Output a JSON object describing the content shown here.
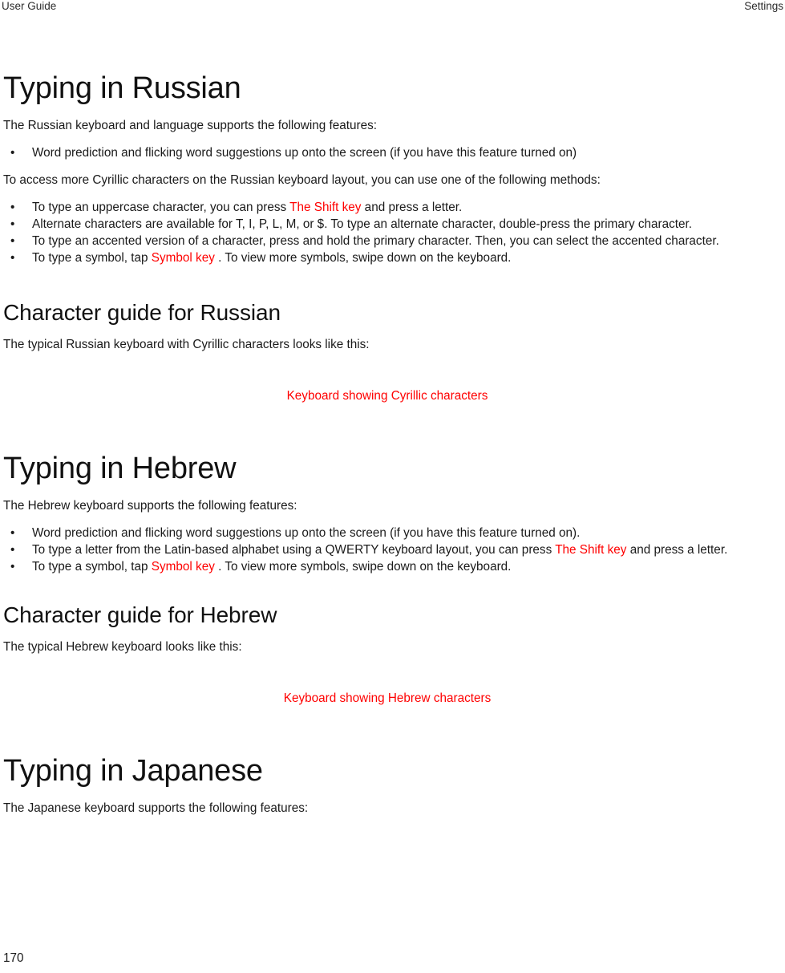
{
  "header": {
    "left": "User Guide",
    "right": "Settings"
  },
  "footer": {
    "page_number": "170"
  },
  "colors": {
    "alt_text_red": "#ff0000",
    "body_text": "#1a1a1a",
    "heading": "#111111",
    "background": "#ffffff"
  },
  "sections": {
    "russian": {
      "heading": "Typing in Russian",
      "intro": "The Russian keyboard and language supports the following features:",
      "features": [
        "Word prediction and flicking word suggestions up onto the screen (if you have this feature turned on)"
      ],
      "methods_intro": "To access more Cyrillic characters on the Russian keyboard layout, you can use one of the following methods:",
      "methods": [
        {
          "pre": "To type an uppercase character, you can press ",
          "alt": "The Shift key",
          "post": " and press a letter."
        },
        {
          "pre": "Alternate characters are available for T, I, P, L, M, or $. To type an alternate character, double-press the primary character.",
          "alt": "",
          "post": ""
        },
        {
          "pre": "To type an accented version of a character, press and hold the primary character. Then, you can select the accented character.",
          "alt": "",
          "post": ""
        },
        {
          "pre": "To type a symbol, tap ",
          "alt": "Symbol key",
          "post": " . To view more symbols, swipe down on the keyboard."
        }
      ],
      "guide_heading": "Character guide for Russian",
      "guide_intro": "The typical Russian keyboard with Cyrillic characters looks like this:",
      "figure_alt": "Keyboard showing Cyrillic characters"
    },
    "hebrew": {
      "heading": "Typing in Hebrew",
      "intro": "The Hebrew keyboard supports the following features:",
      "features": [
        {
          "pre": "Word prediction and flicking word suggestions up onto the screen (if you have this feature turned on).",
          "alt": "",
          "post": ""
        },
        {
          "pre": "To type a letter from the Latin-based alphabet using a QWERTY keyboard layout, you can press ",
          "alt": "The Shift key",
          "post": " and press a letter."
        },
        {
          "pre": "To type a symbol, tap ",
          "alt": "Symbol key",
          "post": " . To view more symbols, swipe down on the keyboard."
        }
      ],
      "guide_heading": "Character guide for Hebrew",
      "guide_intro": "The typical Hebrew keyboard looks like this:",
      "figure_alt": "Keyboard showing Hebrew characters"
    },
    "japanese": {
      "heading": "Typing in Japanese",
      "intro": "The Japanese keyboard supports the following features:"
    }
  }
}
